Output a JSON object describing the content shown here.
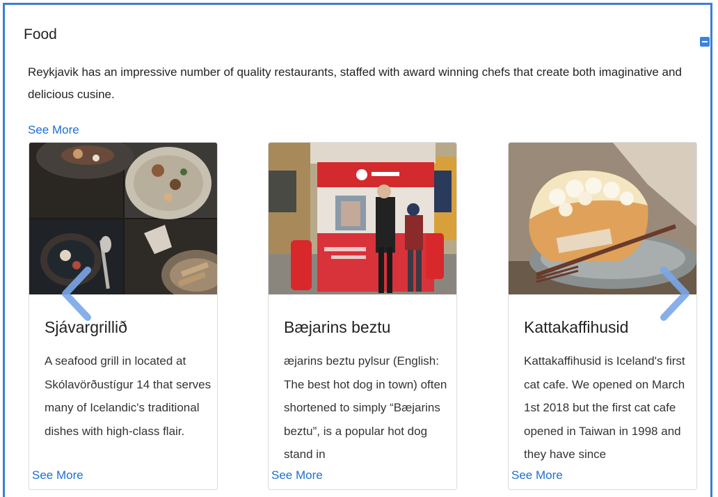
{
  "section": {
    "title": "Food",
    "description": "Reykjavik has an impressive number of quality restaurants, staffed with award winning chefs that create both imaginative and delicious cusine.",
    "see_more": "See More"
  },
  "cards": [
    {
      "title": "Sjávargrillið",
      "text": "A seafood grill in located at Skólavörðustígur 14 that serves many of Icelandic's traditional dishes with high-class flair.",
      "link": "See More",
      "image": "seafood-dishes-photo"
    },
    {
      "title": "Bæjarins beztu",
      "text": "æjarins beztu pylsur (English: The best hot dog in town) often shortened to simply “Bæjarins beztu”, is a popular hot dog stand in",
      "link": "See More",
      "image": "hot-dog-stand-photo"
    },
    {
      "title": "Kattakaffihusid",
      "text": "Kattakaffihusid is Iceland's first cat cafe. We opened on March 1st 2018 but the first cat cafe opened in Taiwan in 1998 and they have since",
      "link": "See More",
      "image": "cake-slice-photo"
    }
  ],
  "colors": {
    "accent": "#3a7fd6",
    "link": "#1a6fd4",
    "arrow": "#7aa6e8"
  },
  "icons": {
    "collapse": "minus-square-icon",
    "prev": "chevron-left-icon",
    "next": "chevron-right-icon"
  }
}
